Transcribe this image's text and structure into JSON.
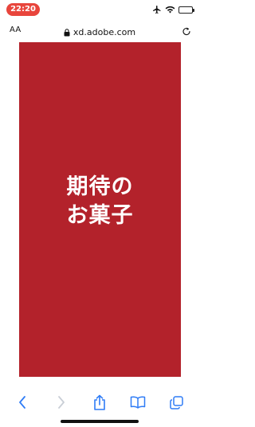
{
  "status_bar": {
    "time": "22:20",
    "icons": [
      "airplane-icon",
      "wifi-icon",
      "battery-icon"
    ]
  },
  "address_bar": {
    "text_size_label": "AA",
    "url": "xd.adobe.com",
    "icons": [
      "lock-icon",
      "reload-icon"
    ]
  },
  "content": {
    "background_color": "#b3222b",
    "title_line_1": "期待の",
    "title_line_2": "お菓子"
  },
  "toolbar": {
    "icons": [
      "back-icon",
      "forward-icon",
      "share-icon",
      "bookmarks-icon",
      "tabs-icon"
    ],
    "accent_color": "#2f7cf6"
  },
  "colors": {
    "time_pill": "#e8453c"
  }
}
